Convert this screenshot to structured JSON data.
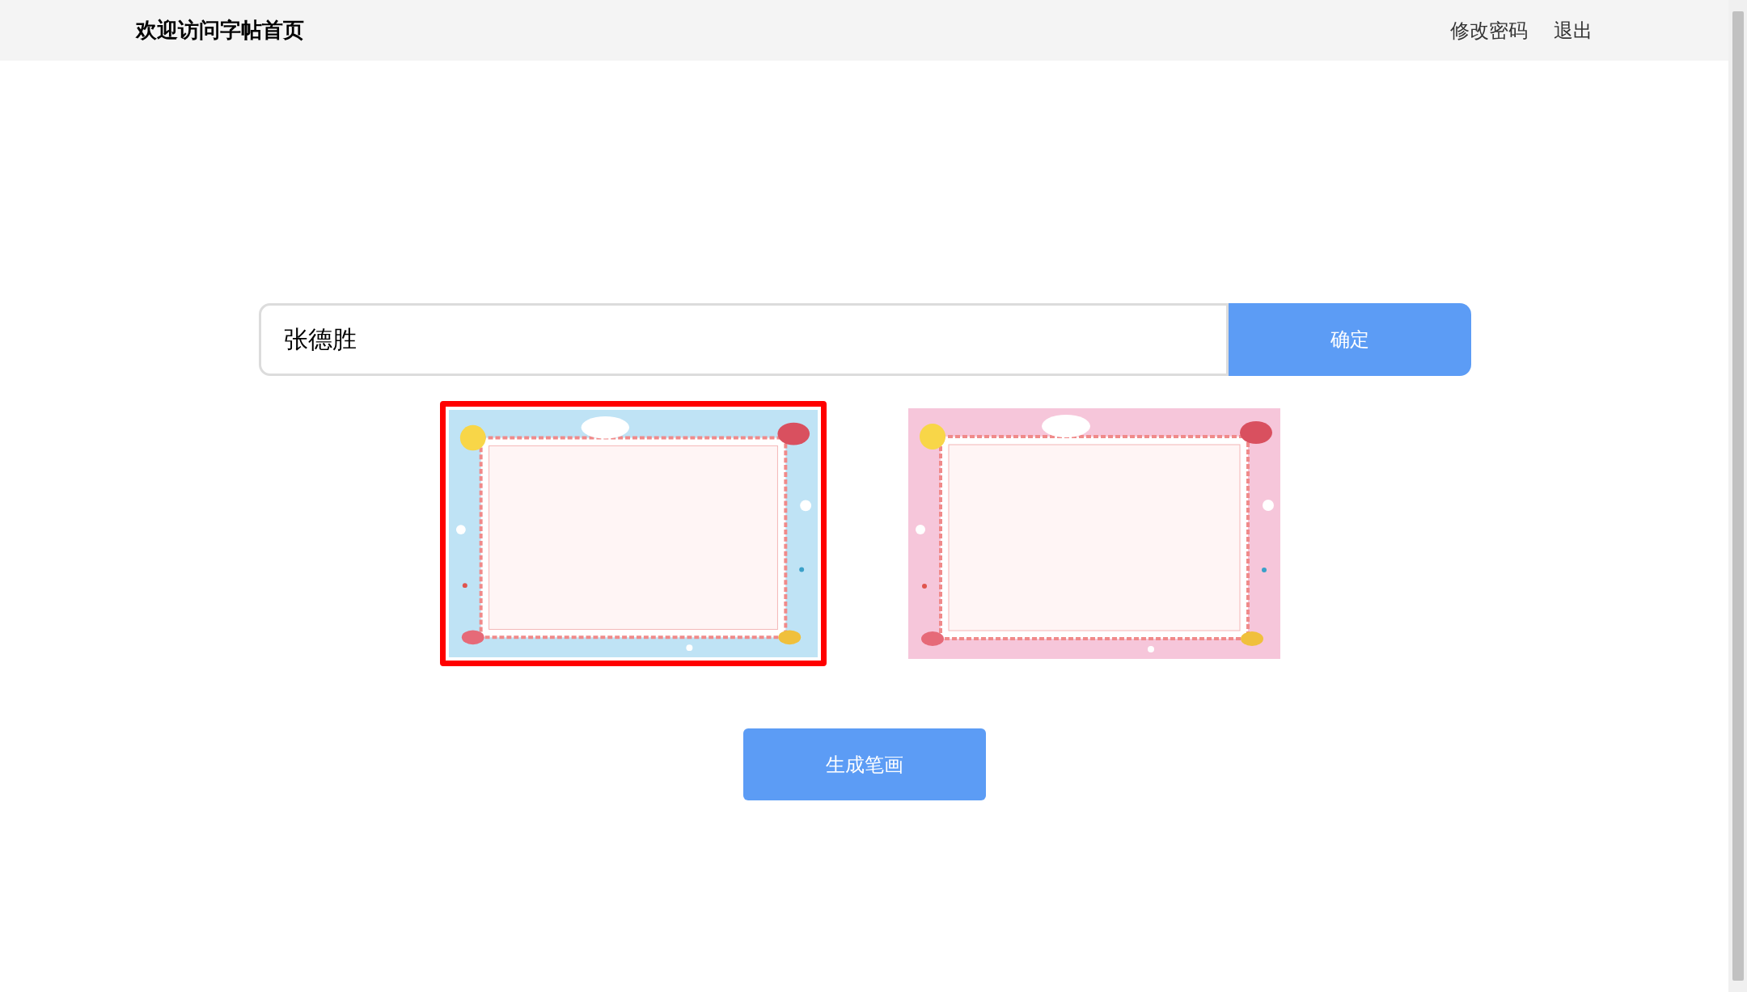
{
  "header": {
    "title": "欢迎访问字帖首页",
    "links": [
      "修改密码",
      "退出"
    ]
  },
  "name_input": {
    "value": "张德胜"
  },
  "confirm_button": "确定",
  "templates": [
    {
      "kind": "picture",
      "selected": true
    },
    {
      "kind": "picture",
      "selected": false
    }
  ],
  "generate_button": "生成笔画"
}
